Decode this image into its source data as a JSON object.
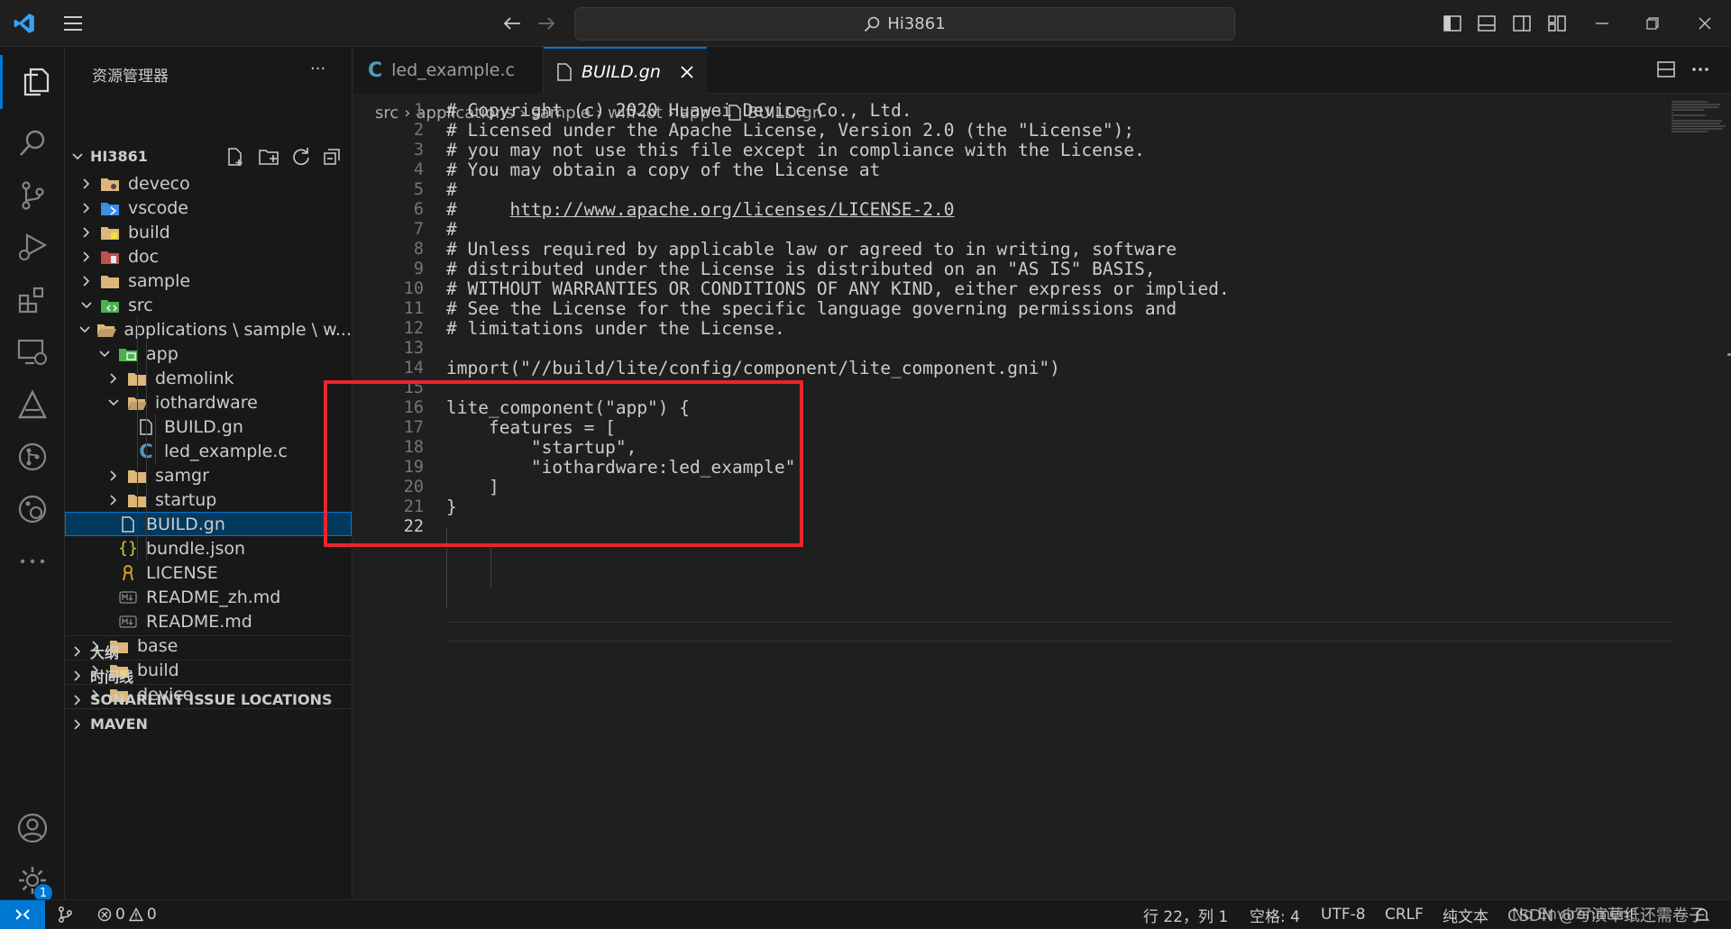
{
  "titlebar": {
    "search_text": "Hi3861"
  },
  "sidebar": {
    "header": "资源管理器",
    "more": "···",
    "root": "HI3861",
    "tree": [
      {
        "label": "deveco",
        "chev": "right",
        "icon": "folder-config",
        "color": "#dcb67a"
      },
      {
        "label": "vscode",
        "chev": "right",
        "icon": "folder-vscode",
        "color": "#3a8ee6"
      },
      {
        "label": "build",
        "chev": "right",
        "icon": "folder-build",
        "color": "#dcb67a"
      },
      {
        "label": "doc",
        "chev": "right",
        "icon": "folder-doc",
        "color": "#c0504d"
      },
      {
        "label": "sample",
        "chev": "right",
        "icon": "folder",
        "color": "#dcb67a"
      },
      {
        "label": "src",
        "chev": "down",
        "icon": "folder-src",
        "color": "#4caf50"
      },
      {
        "label": "applications \\ sample \\ w...",
        "chev": "down",
        "icon": "folder-open",
        "color": "#dcb67a"
      },
      {
        "label": "app",
        "chev": "down",
        "icon": "folder-app",
        "color": "#4caf50"
      },
      {
        "label": "demolink",
        "chev": "right",
        "icon": "folder",
        "color": "#dcb67a"
      },
      {
        "label": "iothardware",
        "chev": "down",
        "icon": "folder-open",
        "color": "#dcb67a"
      },
      {
        "label": "BUILD.gn",
        "chev": "none",
        "icon": "file",
        "color": "#cccccc"
      },
      {
        "label": "led_example.c",
        "chev": "none",
        "icon": "c-file",
        "color": "#519aba"
      },
      {
        "label": "samgr",
        "chev": "right",
        "icon": "folder",
        "color": "#dcb67a"
      },
      {
        "label": "startup",
        "chev": "right",
        "icon": "folder",
        "color": "#dcb67a"
      },
      {
        "label": "BUILD.gn",
        "chev": "none",
        "icon": "file",
        "color": "#cccccc"
      },
      {
        "label": "bundle.json",
        "chev": "none",
        "icon": "json",
        "color": "#cbcb41"
      },
      {
        "label": "LICENSE",
        "chev": "none",
        "icon": "license",
        "color": "#d4a021"
      },
      {
        "label": "README_zh.md",
        "chev": "none",
        "icon": "markdown",
        "color": "#8a8a8a"
      },
      {
        "label": "README.md",
        "chev": "none",
        "icon": "markdown",
        "color": "#8a8a8a"
      },
      {
        "label": "base",
        "chev": "right",
        "icon": "folder",
        "color": "#dcb67a"
      },
      {
        "label": "build",
        "chev": "right",
        "icon": "folder-build",
        "color": "#dcb67a"
      },
      {
        "label": "device",
        "chev": "right",
        "icon": "folder",
        "color": "#dcb67a"
      }
    ],
    "sections": [
      "大纲",
      "时间线",
      "SONARLINT ISSUE LOCATIONS",
      "MAVEN"
    ]
  },
  "tabs": [
    {
      "label": "led_example.c",
      "icon": "c-file"
    },
    {
      "label": "BUILD.gn",
      "icon": "file",
      "active": true
    }
  ],
  "breadcrumb": [
    "src",
    "applications",
    "sample",
    "wifi-iot",
    "app",
    "BUILD.gn"
  ],
  "code": {
    "lines": [
      "# Copyright (c) 2020 Huawei Device Co., Ltd.",
      "# Licensed under the Apache License, Version 2.0 (the \"License\");",
      "# you may not use this file except in compliance with the License.",
      "# You may obtain a copy of the License at",
      "#",
      "#     http://www.apache.org/licenses/LICENSE-2.0",
      "#",
      "# Unless required by applicable law or agreed to in writing, software",
      "# distributed under the License is distributed on an \"AS IS\" BASIS,",
      "# WITHOUT WARRANTIES OR CONDITIONS OF ANY KIND, either express or implied.",
      "# See the License for the specific language governing permissions and",
      "# limitations under the License.",
      "",
      "import(\"//build/lite/config/component/lite_component.gni\")",
      "",
      "lite_component(\"app\") {",
      "    features = [",
      "        \"startup\",",
      "        \"iothardware:led_example\"",
      "    ]",
      "}",
      ""
    ],
    "current_line": 22
  },
  "status": {
    "errors": "0",
    "warnings": "0",
    "position": "行 22，列 1",
    "spaces": "空格: 4",
    "encoding": "UTF-8",
    "eol": "CRLF",
    "language": "纯文本",
    "environment": "No Environment",
    "watermark": "CSDN @写演草纸还需卷子",
    "badge": "1"
  },
  "colors": {
    "accent": "#0078d4",
    "highlight_box": "#e8262e"
  }
}
